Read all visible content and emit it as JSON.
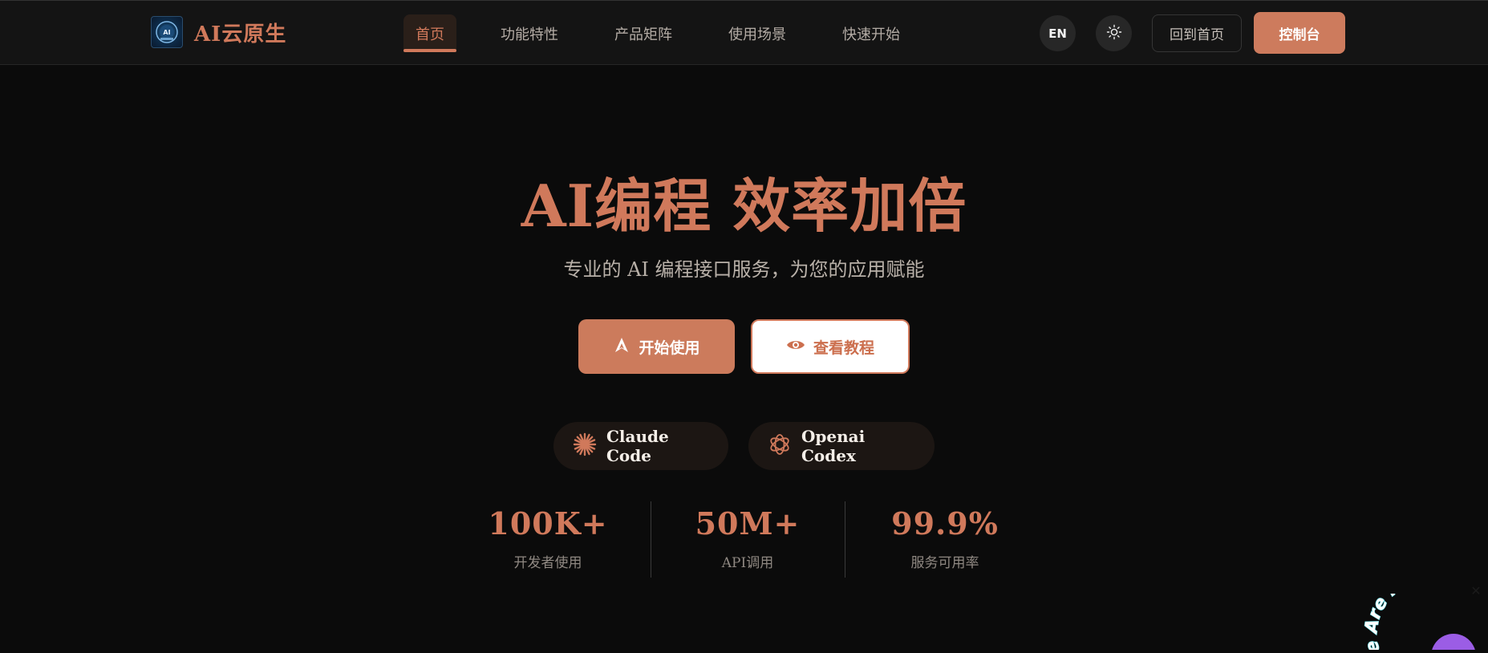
{
  "brand": {
    "name": "AI云原生",
    "logo_icon": "ai-logo-icon"
  },
  "nav": {
    "items": [
      {
        "label": "首页",
        "active": true
      },
      {
        "label": "功能特性",
        "active": false
      },
      {
        "label": "产品矩阵",
        "active": false
      },
      {
        "label": "使用场景",
        "active": false
      },
      {
        "label": "快速开始",
        "active": false
      }
    ]
  },
  "header_actions": {
    "lang_label": "EN",
    "theme_icon": "sun-icon",
    "home_label": "回到首页",
    "console_label": "控制台"
  },
  "hero": {
    "title": "AI编程 效率加倍",
    "subtitle": "专业的 AI 编程接口服务，为您的应用赋能",
    "primary_cta": {
      "label": "开始使用",
      "icon": "rocket-icon"
    },
    "secondary_cta": {
      "label": "查看教程",
      "icon": "eye-icon"
    }
  },
  "products": [
    {
      "label": "Claude Code",
      "icon": "claude-starburst-icon"
    },
    {
      "label": "Openai Codex",
      "icon": "openai-knot-icon"
    }
  ],
  "stats": [
    {
      "value": "100K+",
      "label": "开发者使用"
    },
    {
      "value": "50M+",
      "label": "API调用"
    },
    {
      "value": "99.9%",
      "label": "服务可用率"
    }
  ],
  "floating_badge": {
    "text": "e Are Here!",
    "close_label": "✕"
  },
  "colors": {
    "accent": "#d0795b",
    "background": "#0b0b0b",
    "header_bg": "#141414",
    "chip_bg": "#1c1613",
    "badge_purple": "#9b5de5",
    "badge_cyan": "#6ee7f0"
  }
}
